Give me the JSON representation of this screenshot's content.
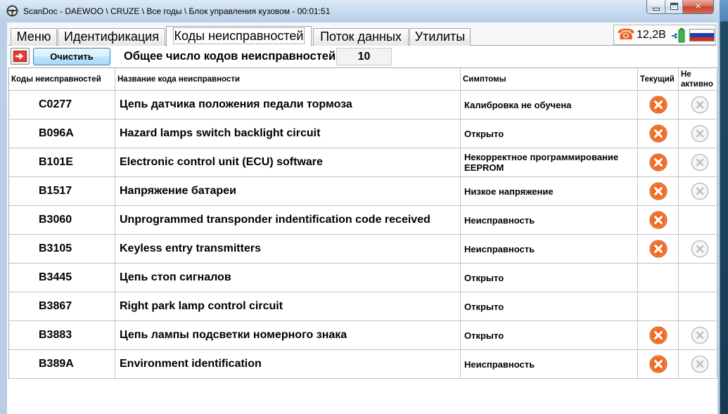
{
  "window": {
    "title": "ScanDoc - DAEWOO \\ CRUZE \\ Все годы \\ Блок управления кузовом - 00:01:51",
    "icon": "steering-wheel-icon",
    "minimize_icon": "minimize-icon",
    "maximize_icon": "maximize-icon",
    "close_icon": "close-icon"
  },
  "tabs": [
    {
      "label": "Меню",
      "active": false
    },
    {
      "label": "Идентификация",
      "active": false
    },
    {
      "label": "Коды неисправностей",
      "active": true
    },
    {
      "label": "Поток данных",
      "active": false
    },
    {
      "label": "Утилиты",
      "active": false
    }
  ],
  "status": {
    "phone_icon": "phone-icon",
    "voltage": "12,2В",
    "battery_icon": "battery-charging-icon",
    "flag_icon": "russia-flag-icon"
  },
  "toolbar": {
    "export_icon": "red-arrow-icon",
    "clear_label": "Очистить",
    "total_label": "Общее число кодов неисправностей",
    "total_value": "10"
  },
  "table": {
    "columns": {
      "code": "Коды неисправностей",
      "name": "Название кода неисправности",
      "symptom": "Симптомы",
      "current": "Текущий",
      "inactive": "Не активно"
    },
    "rows": [
      {
        "code": "C0277",
        "name": "Цепь датчика положения педали тормоза",
        "symptom": "Калибровка не обучена",
        "current": true,
        "inactive": true
      },
      {
        "code": "B096A",
        "name": "Hazard lamps switch backlight circuit",
        "symptom": "Открыто",
        "current": true,
        "inactive": true
      },
      {
        "code": "B101E",
        "name": "Electronic control unit (ECU) software",
        "symptom": "Некорректное программирование EEPROM",
        "current": true,
        "inactive": true
      },
      {
        "code": "B1517",
        "name": "Напряжение батареи",
        "symptom": "Низкое напряжение",
        "current": true,
        "inactive": true
      },
      {
        "code": "B3060",
        "name": "Unprogrammed transponder indentification code received",
        "symptom": "Неисправность",
        "current": true,
        "inactive": false
      },
      {
        "code": "B3105",
        "name": "Keyless entry transmitters",
        "symptom": "Неисправность",
        "current": true,
        "inactive": true
      },
      {
        "code": "B3445",
        "name": "Цепь стоп сигналов",
        "symptom": "Открыто",
        "current": false,
        "inactive": false
      },
      {
        "code": "B3867",
        "name": "Right park lamp control circuit",
        "symptom": "Открыто",
        "current": false,
        "inactive": false
      },
      {
        "code": "B3883",
        "name": "Цепь лампы подсветки номерного знака",
        "symptom": "Открыто",
        "current": true,
        "inactive": true
      },
      {
        "code": "B389A",
        "name": "Environment identification",
        "symptom": "Неисправность",
        "current": true,
        "inactive": true
      }
    ]
  },
  "colors": {
    "current_fault": "#f26a21",
    "current_fault_border": "#d2521a",
    "inactive_fault": "#c0c0c0",
    "close_button": "#c7432e"
  }
}
